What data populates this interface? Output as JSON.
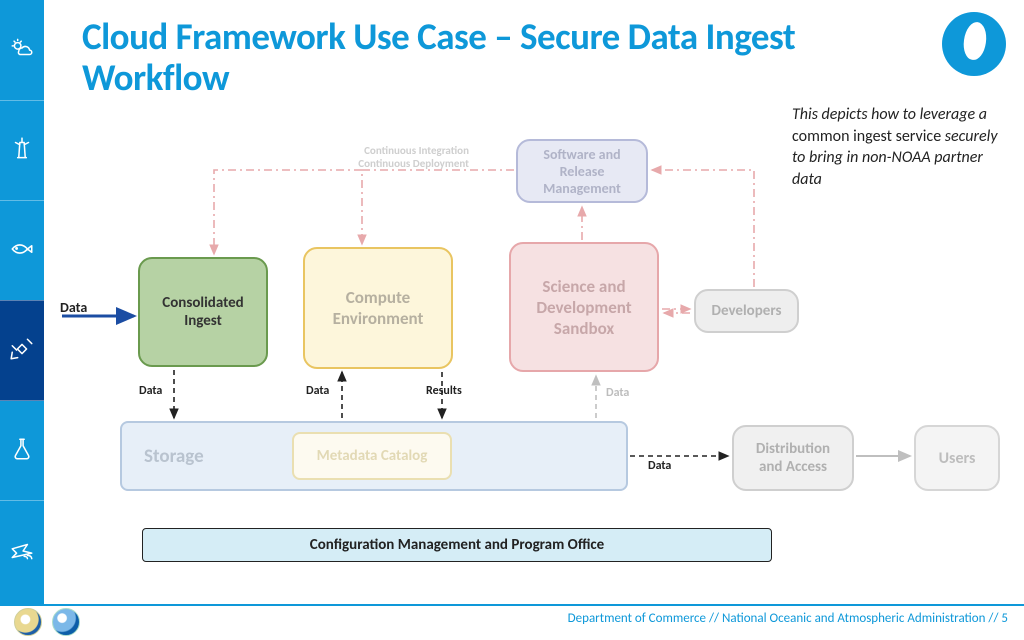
{
  "title": "Cloud Framework Use Case – Secure Data Ingest Workflow",
  "callout": {
    "p1": "This depicts how to leverage a",
    "p2": " common ingest service ",
    "p3": "securely to bring in non-NOAA partner data"
  },
  "boxes": {
    "ingest": "Consolidated Ingest",
    "compute": "Compute Environment",
    "sandbox": "Science and Development Sandbox",
    "srm": "Software and Release Management",
    "dev": "Developers",
    "storage": "Storage",
    "meta": "Metadata Catalog",
    "dist": "Distribution and Access",
    "users": "Users",
    "config": "Configuration Management and Program Office"
  },
  "labels": {
    "data_in": "Data",
    "data1": "Data",
    "data2": "Data",
    "results": "Results",
    "data3": "Data",
    "data4": "Data",
    "ci": "Continuous Integration\nContinuous Deployment"
  },
  "footer": {
    "doc": "Department of Commerce",
    "sep": "  //  ",
    "noaa": "National Oceanic and Atmospheric Administration",
    "page": "5"
  }
}
